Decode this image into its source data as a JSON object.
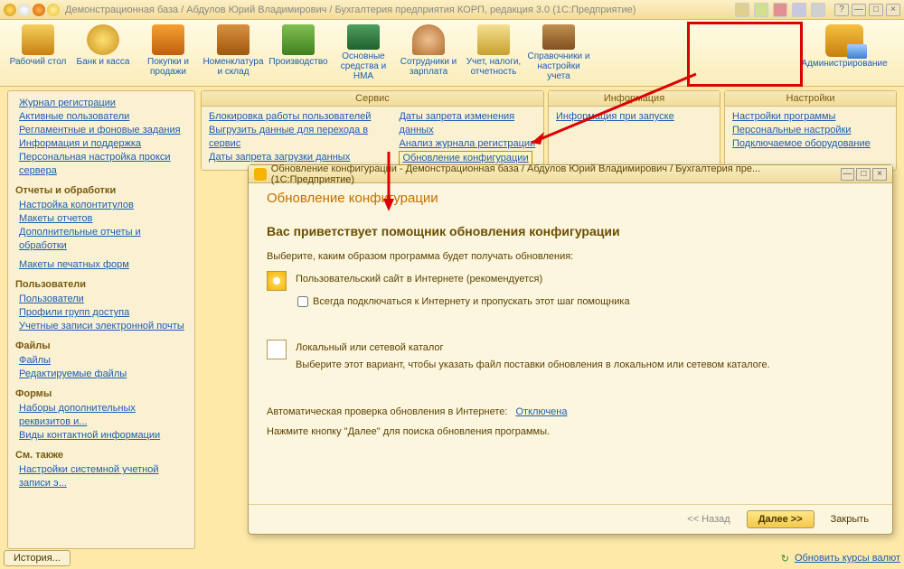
{
  "titlebar": {
    "title": "Демонстрационная база / Абдулов Юрий Владимирович / Бухгалтерия предприятия КОРП, редакция 3.0   (1С:Предприятие)"
  },
  "toolbar": [
    {
      "label": "Рабочий стол"
    },
    {
      "label": "Банк и касса"
    },
    {
      "label": "Покупки и продажи"
    },
    {
      "label": "Номенклатура и склад"
    },
    {
      "label": "Производство"
    },
    {
      "label": "Основные средства и НМА"
    },
    {
      "label": "Сотрудники и зарплата"
    },
    {
      "label": "Учет, налоги, отчетность"
    },
    {
      "label": "Справочники и настройки учета"
    },
    {
      "label": "Администрирование"
    }
  ],
  "panels": {
    "service": {
      "header": "Сервис",
      "col1": [
        "Блокировка работы пользователей",
        "Выгрузить данные для перехода в сервис",
        "Даты запрета загрузки данных"
      ],
      "col2": [
        "Даты запрета изменения данных",
        "Анализ журнала регистрации",
        "Обновление конфигурации"
      ]
    },
    "info": {
      "header": "Информация",
      "items": [
        "Информация при запуске"
      ]
    },
    "settings": {
      "header": "Настройки",
      "items": [
        "Настройки программы",
        "Персональные настройки",
        "Подключаемое оборудование"
      ]
    }
  },
  "sidebar": {
    "g1": [
      "Журнал регистрации",
      "Активные пользователи",
      "Регламентные и фоновые задания",
      "Информация и поддержка",
      "Персональная настройка прокси сервера"
    ],
    "g2_hdr": "Отчеты и обработки",
    "g2": [
      "Настройка колонтитулов",
      "Макеты отчетов",
      "Дополнительные отчеты и обработки"
    ],
    "g2b": [
      "Макеты печатных форм"
    ],
    "g3_hdr": "Пользователи",
    "g3": [
      "Пользователи",
      "Профили групп доступа",
      "Учетные записи электронной почты"
    ],
    "g4_hdr": "Файлы",
    "g4": [
      "Файлы",
      "Редактируемые файлы"
    ],
    "g5_hdr": "Формы",
    "g5": [
      "Наборы дополнительных реквизитов и...",
      "Виды контактной информации"
    ],
    "g6_hdr": "См. также",
    "g6": [
      "Настройки системной учетной записи э..."
    ]
  },
  "dialog": {
    "title": "Обновление конфигурации - Демонстрационная база / Абдулов Юрий Владимирович / Бухгалтерия пре...   (1С:Предприятие)",
    "h1": "Обновление конфигурации",
    "h2": "Вас приветствует помощник обновления конфигурации",
    "p1": "Выберите, каким образом программа будет получать обновления:",
    "opt1": "Пользовательский сайт в Интернете (рекомендуется)",
    "chk1": "Всегда подключаться к Интернету и пропускать этот шаг помощника",
    "opt2": "Локальный или сетевой каталог",
    "opt2b": "Выберите этот вариант, чтобы указать файл поставки обновления в локальном или сетевом каталоге.",
    "auto": "Автоматическая проверка обновления в Интернете:",
    "auto_link": "Отключена",
    "hint": "Нажмите кнопку \"Далее\" для поиска обновления программы.",
    "back": "<< Назад",
    "next": "Далее >>",
    "close": "Закрыть"
  },
  "statusbar": {
    "history": "История...",
    "refresh": "Обновить курсы валют"
  }
}
